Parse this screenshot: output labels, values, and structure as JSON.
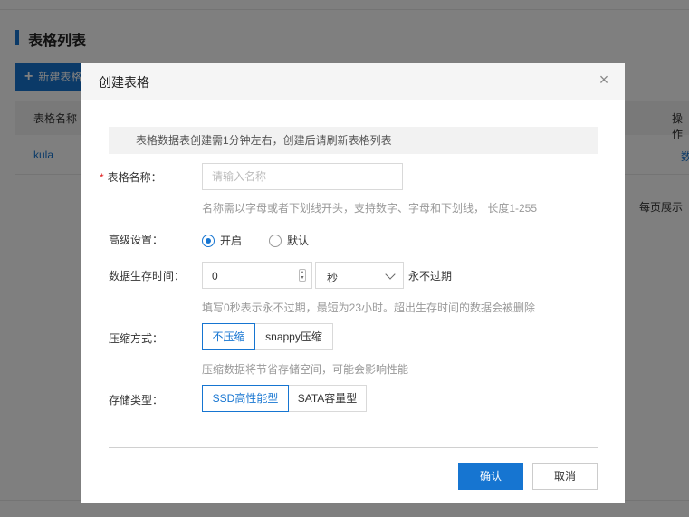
{
  "background": {
    "page_title": "表格列表",
    "new_table_button": "新建表格",
    "table": {
      "headers": [
        "表格名称",
        "操作"
      ],
      "rows": [
        [
          "kula",
          "数"
        ]
      ]
    },
    "per_page_label": "每页展示"
  },
  "modal": {
    "title": "创建表格",
    "close_glyph": "×",
    "notice": "表格数据表创建需1分钟左右，创建后请刷新表格列表",
    "fields": {
      "name": {
        "required_mark": "*",
        "label": "表格名称：",
        "placeholder": "请输入名称",
        "value": "",
        "hint": "名称需以字母或者下划线开头，支持数字、字母和下划线， 长度1-255"
      },
      "advanced": {
        "label": "高级设置：",
        "options": [
          "开启",
          "默认"
        ],
        "selected": "开启"
      },
      "ttl": {
        "label": "数据生存时间：",
        "value": "0",
        "unit": "秒",
        "suffix": "永不过期",
        "hint": "填写0秒表示永不过期，最短为23小时。超出生存时间的数据会被删除"
      },
      "compression": {
        "label": "压缩方式：",
        "options": [
          "不压缩",
          "snappy压缩"
        ],
        "selected": "不压缩",
        "hint": "压缩数据将节省存储空间，可能会影响性能"
      },
      "storage": {
        "label": "存储类型：",
        "options": [
          "SSD高性能型",
          "SATA容量型"
        ],
        "selected": "SSD高性能型"
      }
    },
    "buttons": {
      "confirm": "确认",
      "cancel": "取消"
    }
  },
  "colors": {
    "accent": "#1675d1",
    "required": "#e02020",
    "overlay": "rgba(0,0,0,0.5)"
  }
}
